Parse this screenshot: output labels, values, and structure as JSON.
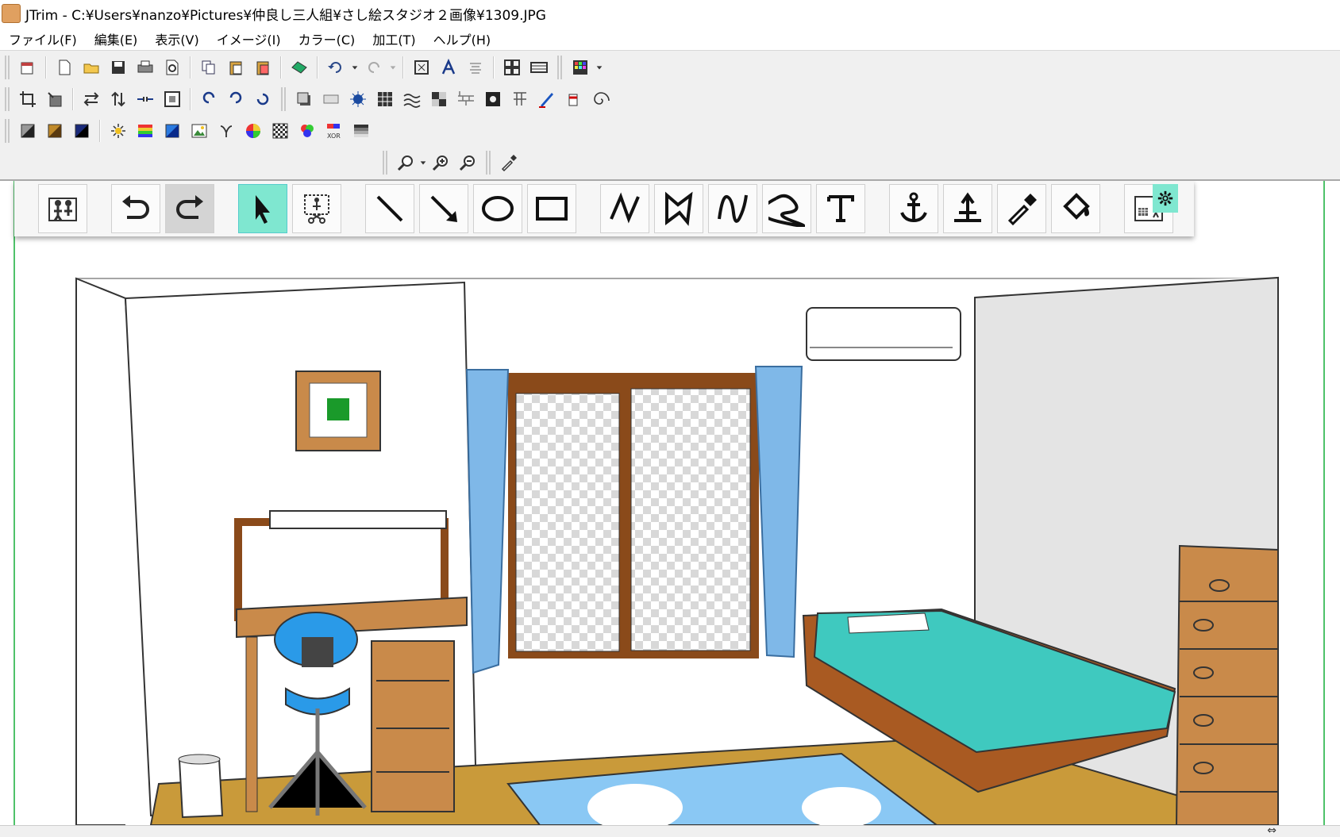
{
  "window": {
    "title": "JTrim - C:¥Users¥nanzo¥Pictures¥仲良し三人組¥さし絵スタジオ２画像¥1309.JPG"
  },
  "menu": [
    "ファイル(F)",
    "編集(E)",
    "表示(V)",
    "イメージ(I)",
    "カラー(C)",
    "加工(T)",
    "ヘルプ(H)"
  ],
  "colors": {
    "accent": "#7fe7d0",
    "guide": "#4ec26a",
    "floor": "#c99a3a",
    "bed": "#3fc9bf",
    "curtain": "#7fb8e8"
  },
  "statusbar": {
    "resize_glyph": "⇔"
  }
}
